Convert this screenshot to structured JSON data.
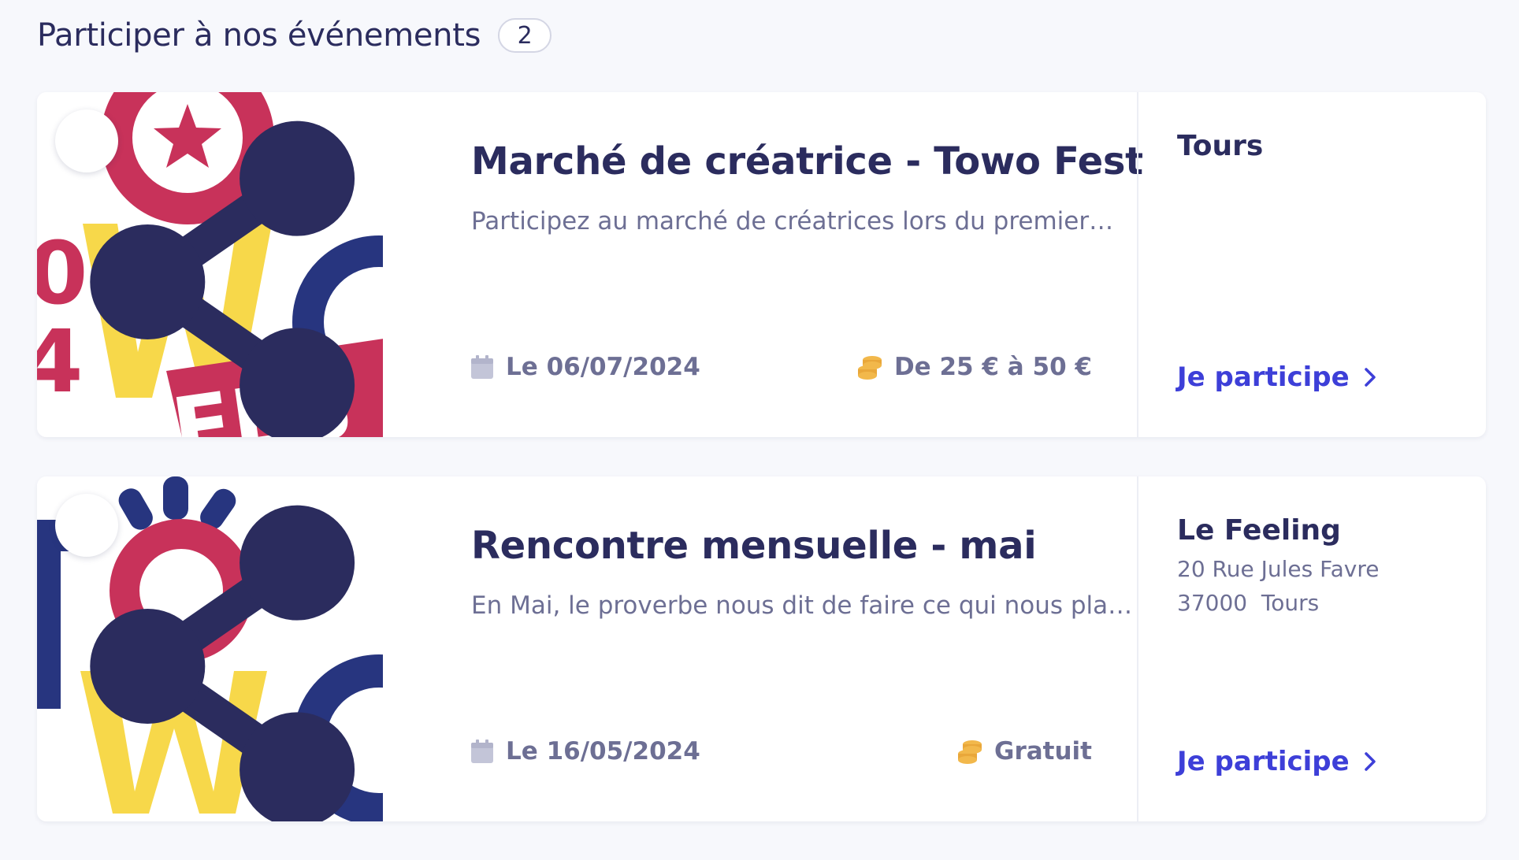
{
  "section": {
    "title": "Participer à nos événements",
    "count": "2"
  },
  "events": [
    {
      "title": "Marché de créatrice - Towo Fest",
      "description": "Participez au marché de créatrices lors du premier…",
      "date": "Le 06/07/2024",
      "price": "De 25 € à 50 €",
      "location_name": "Tours",
      "address_line1": "",
      "address_line2": "",
      "cta": "Je participe"
    },
    {
      "title": "Rencontre mensuelle - mai",
      "description": "En Mai, le proverbe nous dit de faire ce qui nous plait !…",
      "date": "Le 16/05/2024",
      "price": "Gratuit",
      "location_name": "Le Feeling",
      "address_line1": "20 Rue Jules Favre",
      "address_line2": "37000  Tours",
      "cta": "Je participe"
    }
  ],
  "icons": {
    "share": "share-icon",
    "calendar": "calendar-icon",
    "coins": "coins-icon",
    "chevron": "chevron-right-icon"
  },
  "colors": {
    "logo_red": "#c8325a",
    "logo_yellow": "#f7d84a",
    "logo_blue": "#27357f",
    "link": "#3d3fd8",
    "coins": "#f2b84b"
  }
}
